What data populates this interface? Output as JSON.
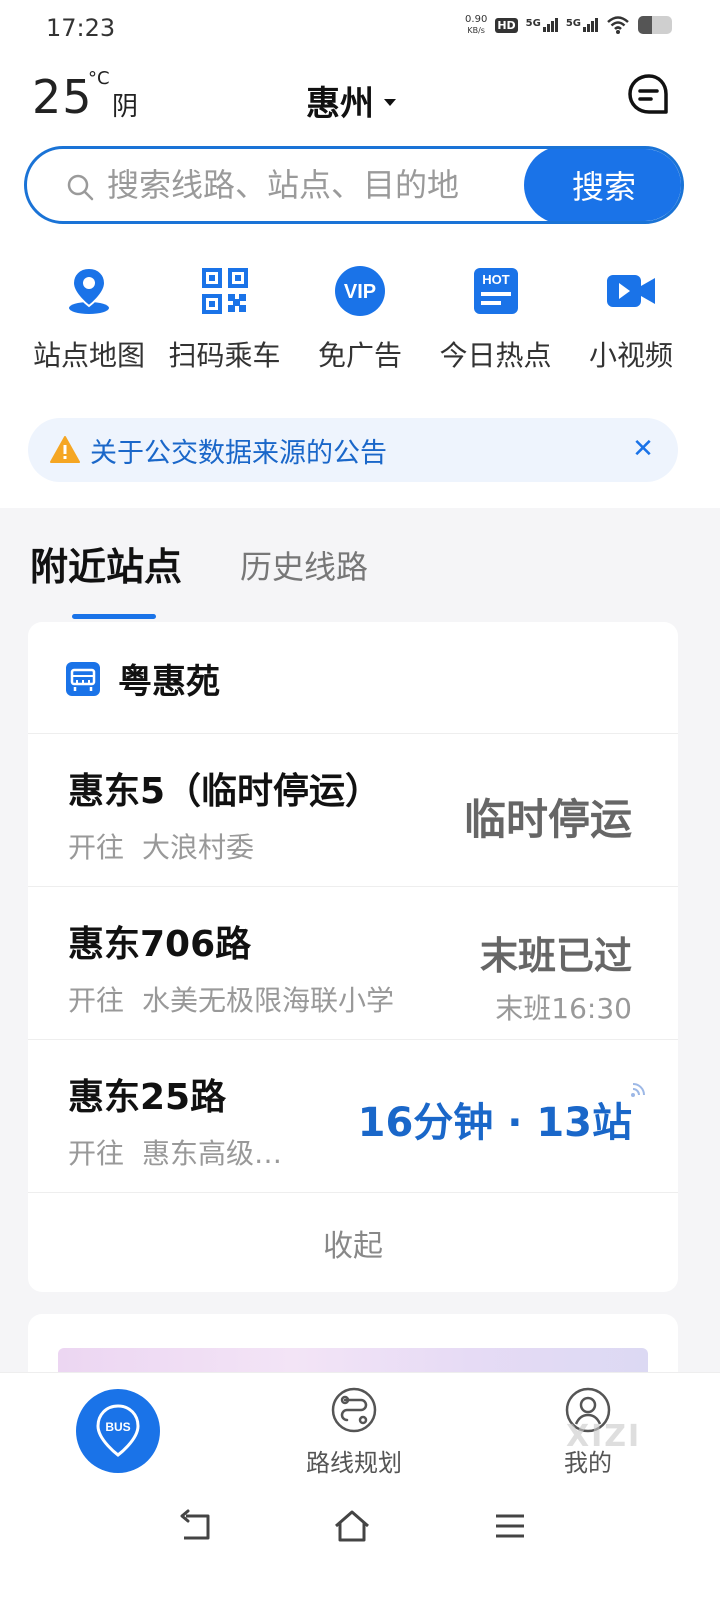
{
  "status_bar": {
    "time": "17:23",
    "net_speed_value": "0.90",
    "net_speed_unit": "KB/s",
    "hd_label": "HD",
    "sim1_label": "5G",
    "sim2_label": "5G"
  },
  "header": {
    "temperature": "25",
    "temp_unit": "°C",
    "weather": "阴",
    "city": "惠州"
  },
  "search": {
    "placeholder": "搜索线路、站点、目的地",
    "button_label": "搜索"
  },
  "quick_actions": [
    {
      "label": "站点地图",
      "icon": "map-pin-icon"
    },
    {
      "label": "扫码乘车",
      "icon": "qr-code-icon"
    },
    {
      "label": "免广告",
      "icon": "vip-icon",
      "icon_text": "VIP"
    },
    {
      "label": "今日热点",
      "icon": "hot-news-icon",
      "icon_text": "HOT"
    },
    {
      "label": "小视频",
      "icon": "video-camera-icon"
    }
  ],
  "notice": {
    "text": "关于公交数据来源的公告"
  },
  "tabs": {
    "active": "附近站点",
    "inactive": "历史线路"
  },
  "stop": {
    "name": "粤惠苑",
    "routes": [
      {
        "name": "惠东5（临时停运）",
        "direction_prefix": "开往",
        "destination": "大浪村委",
        "status": "临时停运",
        "sub_status": ""
      },
      {
        "name": "惠东706路",
        "direction_prefix": "开往",
        "destination": "水美无极限海联小学",
        "status": "末班已过",
        "sub_status": "末班16:30"
      },
      {
        "name": "惠东25路",
        "direction_prefix": "开往",
        "destination": "惠东高级…",
        "status": "16分钟 · 13站",
        "sub_status": ""
      }
    ],
    "collapse_label": "收起"
  },
  "bottom_nav": {
    "bus_label": "BUS",
    "route_plan_label": "路线规划",
    "mine_label": "我的",
    "watermark": "XIZI"
  },
  "colors": {
    "accent": "#1a73e8",
    "notice_bg": "#eef4fd",
    "section_bg": "#f5f5f7"
  }
}
